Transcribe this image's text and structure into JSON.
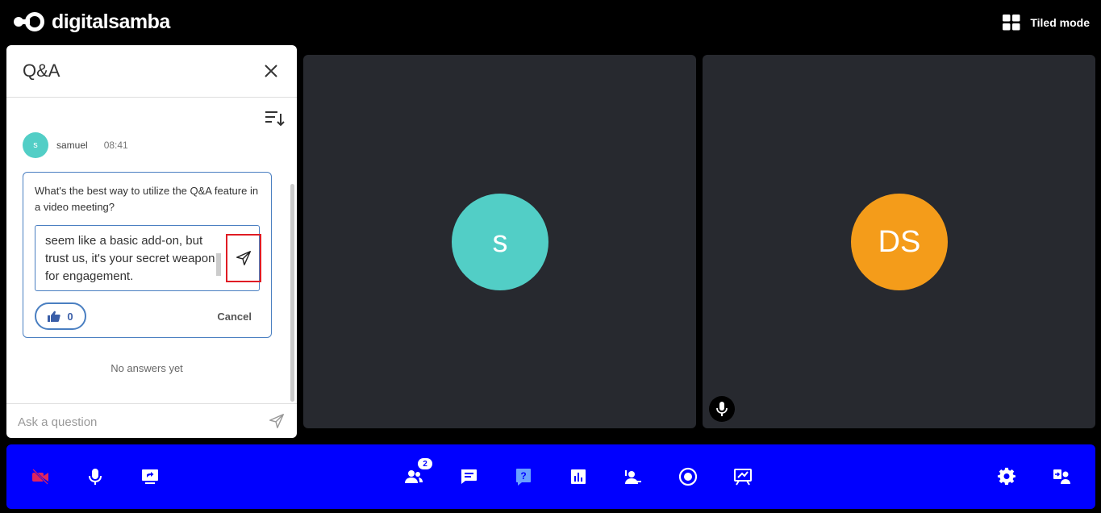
{
  "header": {
    "logo_text": "digitalsamba",
    "tiled_mode_label": "Tiled mode"
  },
  "qa": {
    "title": "Q&A",
    "question": {
      "author_initial": "s",
      "author_name": "samuel",
      "time": "08:41",
      "text": "What's the best way to utilize the Q&A feature in a video meeting?",
      "answer_draft": "seem like a basic add-on, but trust us, it's your secret weapon for engagement.",
      "like_count": "0",
      "cancel_label": "Cancel"
    },
    "no_answers_text": "No answers yet",
    "ask_placeholder": "Ask a question"
  },
  "tiles": [
    {
      "initials": "s",
      "color": "#52cec6"
    },
    {
      "initials": "DS",
      "color": "#f49c1a"
    }
  ],
  "toolbar": {
    "participants_count": "2",
    "colors": {
      "background": "#0000ff",
      "camera_off": "#e0245e",
      "qa_active": "#6aa0ff"
    }
  }
}
